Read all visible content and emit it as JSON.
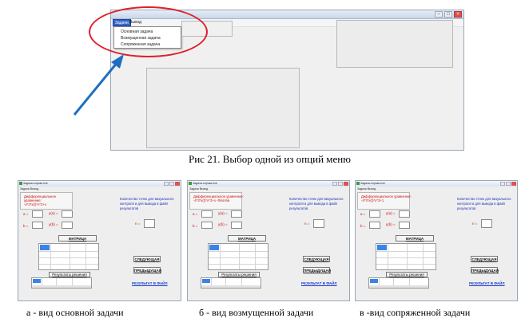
{
  "top_window": {
    "menu": {
      "tasks": "Задачи",
      "exit": "Выход"
    },
    "dropdown": [
      "Основная задача",
      "Возмущенная задача",
      "Сопряженная задача"
    ],
    "title_buttons": {
      "minimize": "–",
      "maximize": "□",
      "close": "×"
    }
  },
  "caption_top": "Рис 21. Выбор одной из опций меню",
  "mini_windows": [
    {
      "title": "Задачи-случаи.exe",
      "menu": "Задачи  Выход",
      "eq_line1": "Дифференциальное",
      "eq_line2": "уравнение:",
      "eq_line3": "-4*3*x(t)*x^3+x",
      "right_text": [
        "Количество точек для визуального",
        "контроля и для вывода в файл",
        "результатов"
      ],
      "n_label": "n =",
      "a_label": "a =",
      "b_label": "b =",
      "ya_label": "y(a) =",
      "yb_label": "y(b) =",
      "matrix_btn": "МАТРИЦА",
      "next_btn": "СЛЕДУЮЩАЯ",
      "prev_btn": "ПРЕДЫДУЩАЯ",
      "results_btn": "Результаты решения",
      "file_link": "РЕЗУЛЬТАТ В ФАЙЛ"
    },
    {
      "title": "Задачи-случаи.exe",
      "menu": "Задачи  Выход",
      "eq_line1": "Дифференциальное уравнение:",
      "eq_line2": "-4*3*x(t)*x^3+x -Флоппи",
      "eq_line3": "",
      "right_text": [
        "Количество точек для визуального",
        "контроля и для вывода в файл",
        "результатов"
      ],
      "n_label": "n =",
      "a_label": "a =",
      "b_label": "b =",
      "ya_label": "y(a) =",
      "yb_label": "y(b) =",
      "matrix_btn": "МАТРИЦА",
      "next_btn": "СЛЕДУЮЩАЯ",
      "prev_btn": "ПРЕДЫДУЩАЯ",
      "results_btn": "Результаты решения",
      "file_link": "РЕЗУЛЬТАТ В ФАЙЛ"
    },
    {
      "title": "Задачи-случаи.exe",
      "menu": "Задачи  Выход",
      "eq_line1": "Дифференциальное уравнение:",
      "eq_line2": "-4*3*x(t)*x^3+1",
      "eq_line3": "",
      "right_text": [
        "Количество точек для визуального",
        "контроля и для вывода в файл",
        "результатов"
      ],
      "n_label": "n =",
      "a_label": "a =",
      "b_label": "b =",
      "ya_label": "y(a) =",
      "yb_label": "y(b) =",
      "matrix_btn": "МАТРИЦА",
      "next_btn": "СЛЕДУЮЩАЯ",
      "prev_btn": "ПРЕДЫДУЩАЯ",
      "results_btn": "Результаты решения",
      "file_link": "РЕЗУЛЬТАТ В ФАЙЛ"
    }
  ],
  "captions_bottom": [
    "а - вид основной задачи",
    "б - вид возмущенной задачи",
    "в -вид сопряженной задачи"
  ],
  "colors": {
    "highlight": "#e0202a",
    "arrow": "#1f6fc0",
    "accent_blue": "#3b83e6"
  }
}
